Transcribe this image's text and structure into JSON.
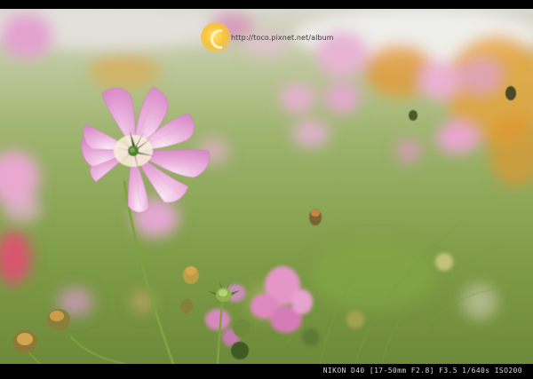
{
  "watermark": {
    "url_text": "http://toco.pixnet.net/album",
    "logo_icon": "circular-logo-icon"
  },
  "caption": {
    "exif_text": "NIKON D40 [17-50mm F2.8] F3.5 1/640s ISO200"
  },
  "colors": {
    "border": "#000000",
    "petal": "#e9a7d8",
    "petal_highlight": "#f7e0f1",
    "sepal_green": "#3f6b2a",
    "background_green": "#8fae5e"
  }
}
